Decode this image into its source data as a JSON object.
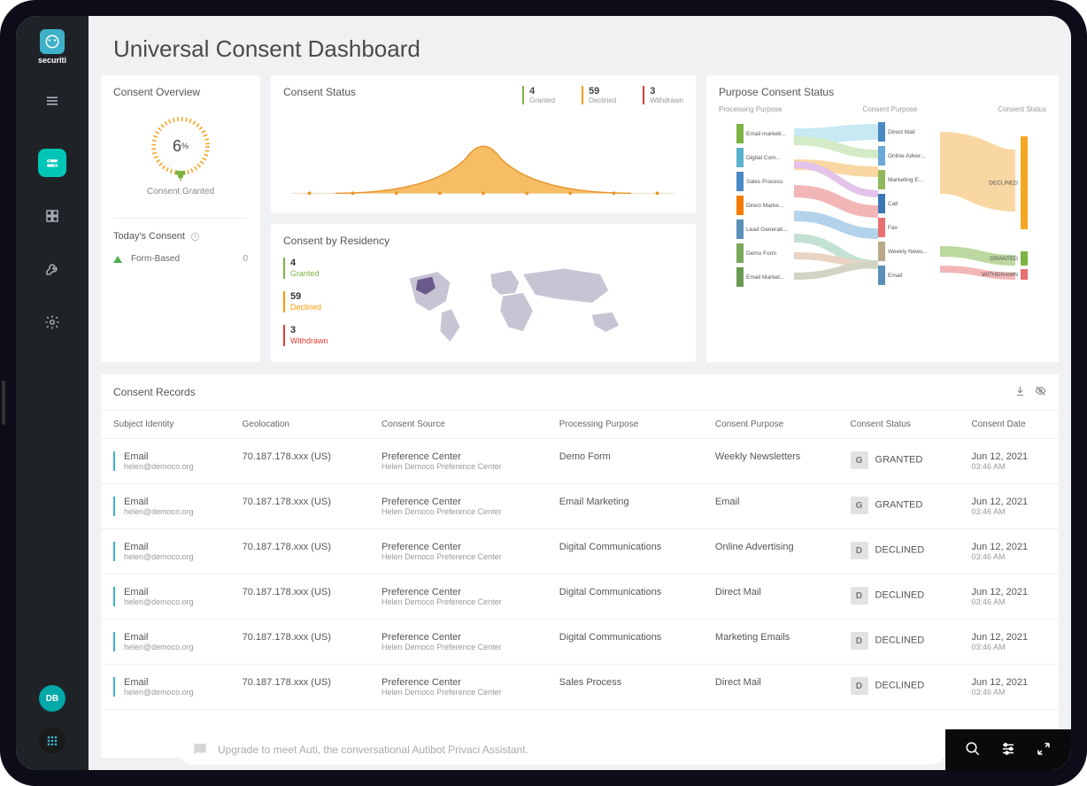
{
  "brand": "securiti",
  "page_title": "Universal Consent Dashboard",
  "sidebar": {
    "avatar": "DB"
  },
  "overview": {
    "title": "Consent Overview",
    "pct": "6",
    "pct_symbol": "%",
    "label": "Consent Granted",
    "today_hdr": "Today's Consent",
    "formbased_label": "Form-Based",
    "formbased_count": "0"
  },
  "status": {
    "title": "Consent Status",
    "granted_n": "4",
    "granted_l": "Granted",
    "declined_n": "59",
    "declined_l": "Declined",
    "withdrawn_n": "3",
    "withdrawn_l": "Withdrawn"
  },
  "residency": {
    "title": "Consent by Residency",
    "granted_n": "4",
    "granted_l": "Granted",
    "declined_n": "59",
    "declined_l": "Declined",
    "withdrawn_n": "3",
    "withdrawn_l": "Withdrawn"
  },
  "sankey": {
    "title": "Purpose Consent Status",
    "col1": "Processing Purpose",
    "col2": "Consent Purpose",
    "col3": "Consent Status",
    "left": [
      "Email marketi...",
      "Digital Com...",
      "Sales Process",
      "Direct Marke...",
      "Lead Generati...",
      "Demo Form",
      "Email Market..."
    ],
    "mid": [
      "Direct Mail",
      "Online Adver...",
      "Marketing E...",
      "Call",
      "Fax",
      "Weekly News...",
      "Email"
    ],
    "right": [
      "DECLINED",
      "GRANTED",
      "WITHDRAWN"
    ]
  },
  "records": {
    "title": "Consent Records",
    "headers": [
      "Subject Identity",
      "Geolocation",
      "Consent Source",
      "Processing Purpose",
      "Consent Purpose",
      "Consent Status",
      "Consent Date"
    ],
    "rows": [
      {
        "ident": "Email",
        "email": "helen@democo.org",
        "geo": "70.187.178.xxx (US)",
        "src": "Preference Center",
        "srcsub": "Helen Democo Preference Center",
        "proc": "Demo Form",
        "purpose": "Weekly Newsletters",
        "statusCode": "G",
        "status": "GRANTED",
        "date": "Jun 12, 2021",
        "time": "03:46 AM"
      },
      {
        "ident": "Email",
        "email": "helen@democo.org",
        "geo": "70.187.178.xxx (US)",
        "src": "Preference Center",
        "srcsub": "Helen Democo Preference Center",
        "proc": "Email Marketing",
        "purpose": "Email",
        "statusCode": "G",
        "status": "GRANTED",
        "date": "Jun 12, 2021",
        "time": "03:46 AM"
      },
      {
        "ident": "Email",
        "email": "helen@democo.org",
        "geo": "70.187.178.xxx (US)",
        "src": "Preference Center",
        "srcsub": "Helen Democo Preference Center",
        "proc": "Digital Communications",
        "purpose": "Online Advertising",
        "statusCode": "D",
        "status": "DECLINED",
        "date": "Jun 12, 2021",
        "time": "03:46 AM"
      },
      {
        "ident": "Email",
        "email": "helen@democo.org",
        "geo": "70.187.178.xxx (US)",
        "src": "Preference Center",
        "srcsub": "Helen Democo Preference Center",
        "proc": "Digital Communications",
        "purpose": "Direct Mail",
        "statusCode": "D",
        "status": "DECLINED",
        "date": "Jun 12, 2021",
        "time": "03:46 AM"
      },
      {
        "ident": "Email",
        "email": "helen@democo.org",
        "geo": "70.187.178.xxx (US)",
        "src": "Preference Center",
        "srcsub": "Helen Democo Preference Center",
        "proc": "Digital Communications",
        "purpose": "Marketing Emails",
        "statusCode": "D",
        "status": "DECLINED",
        "date": "Jun 12, 2021",
        "time": "03:46 AM"
      },
      {
        "ident": "Email",
        "email": "helen@democo.org",
        "geo": "70.187.178.xxx (US)",
        "src": "Preference Center",
        "srcsub": "Helen Democo Preference Center",
        "proc": "Sales Process",
        "purpose": "Direct Mail",
        "statusCode": "D",
        "status": "DECLINED",
        "date": "Jun 12, 2021",
        "time": "03:46 AM"
      }
    ]
  },
  "assistant_text": "Upgrade to meet Auti, the conversational Autibot Privaci Assistant.",
  "chart_data": [
    {
      "type": "area",
      "title": "Consent Status",
      "series": [
        {
          "name": "consent",
          "values": [
            0,
            0.5,
            1,
            2,
            5,
            10,
            17,
            24,
            28,
            30,
            28,
            24,
            17,
            10,
            5,
            2,
            1,
            0.5,
            0
          ]
        }
      ],
      "xticks_count": 19
    },
    {
      "type": "sankey",
      "title": "Purpose Consent Status",
      "nodes": {
        "processing_purpose": [
          "Email marketing",
          "Digital Communications",
          "Sales Process",
          "Direct Marketing",
          "Lead Generation",
          "Demo Form",
          "Email Marketing"
        ],
        "consent_purpose": [
          "Direct Mail",
          "Online Advertising",
          "Marketing Emails",
          "Call",
          "Fax",
          "Weekly Newsletters",
          "Email"
        ],
        "consent_status": [
          "DECLINED",
          "GRANTED",
          "WITHDRAWN"
        ]
      }
    }
  ]
}
